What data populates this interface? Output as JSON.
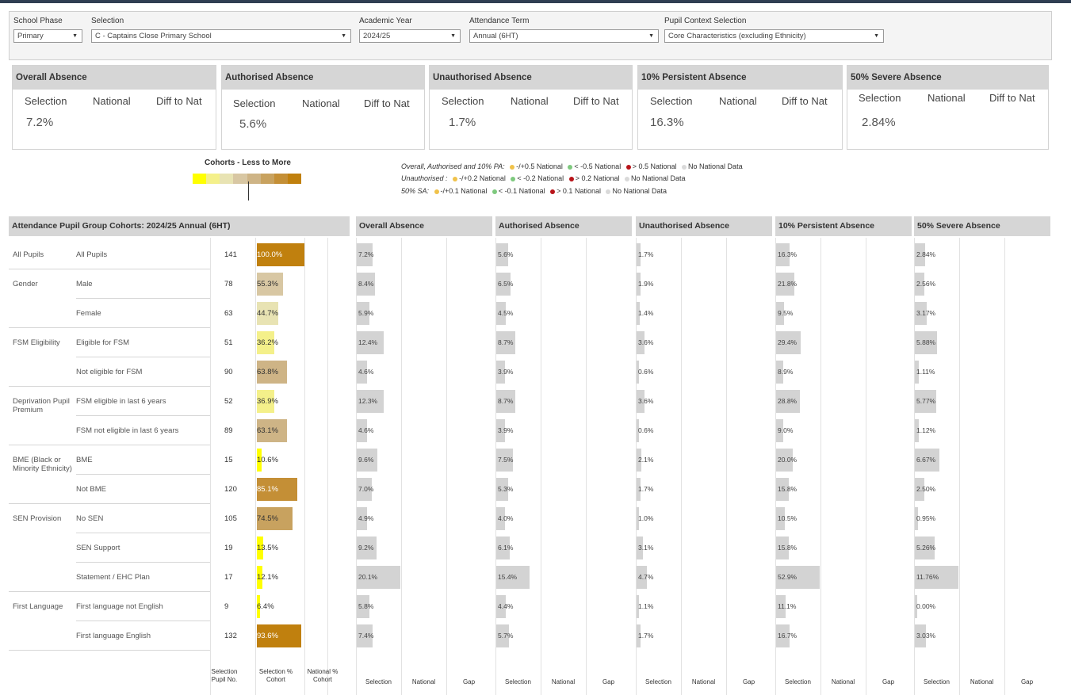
{
  "filters": {
    "school_phase": {
      "label": "School Phase",
      "value": "Primary"
    },
    "selection": {
      "label": "Selection",
      "value": "C - Captains Close Primary School"
    },
    "academic_year": {
      "label": "Academic Year",
      "value": "2024/25"
    },
    "attendance_term": {
      "label": "Attendance Term",
      "value": "Annual (6HT)"
    },
    "pupil_context": {
      "label": "Pupil Context Selection",
      "value": "Core Characteristics (excluding Ethnicity)"
    }
  },
  "kpi_col_labels": {
    "selection": "Selection",
    "national": "National",
    "diff": "Diff to Nat"
  },
  "kpis": [
    {
      "title": "Overall Absence",
      "selection": "7.2%"
    },
    {
      "title": "Authorised Absence",
      "selection": "5.6%"
    },
    {
      "title": "Unauthorised Absence",
      "selection": "1.7%"
    },
    {
      "title": "10% Persistent Absence",
      "selection": "16.3%"
    },
    {
      "title": "50% Severe Absence",
      "selection": "2.84%"
    }
  ],
  "cohort_legend": {
    "title": "Cohorts - Less to More",
    "colors": [
      "#ffff00",
      "#f4f08a",
      "#e8e3b3",
      "#d8c7a3",
      "#ceb486",
      "#c8a25f",
      "#c48f36",
      "#c0800e"
    ]
  },
  "rag_legend": {
    "line1_prefix": "Overall, Authorised and 10% PA:",
    "line1_items": [
      "-/+0.5 National",
      "< -0.5 National",
      "> 0.5 National",
      "No National Data"
    ],
    "line2_prefix": "Unauthorised :",
    "line2_items": [
      "-/+0.2 National",
      "< -0.2 National",
      "> 0.2 National",
      "No National Data"
    ],
    "line3_prefix": "50% SA:",
    "line3_items": [
      "-/+0.1 National",
      "< -0.1 National",
      "> 0.1 National",
      "No National Data"
    ],
    "colors": {
      "amber": "#f0c24a",
      "green": "#7ec97e",
      "red": "#b8141a",
      "grey": "#d9d9d9"
    }
  },
  "table_title": "Attendance Pupil Group Cohorts: 2024/25 Annual (6HT)",
  "metric_headers": [
    "Overall Absence",
    "Authorised Absence",
    "Unauthorised Absence",
    "10% Persistent Absence",
    "50% Severe Absence"
  ],
  "rows": [
    {
      "group": "All Pupils",
      "sub": "All Pupils",
      "n": "141",
      "pct": "100.0%",
      "pct_value": 100.0,
      "color": "#c0800e",
      "vals": [
        "7.2%",
        "5.6%",
        "1.7%",
        "16.3%",
        "2.84%"
      ]
    },
    {
      "group": "Gender",
      "sub": "Male",
      "n": "78",
      "pct": "55.3%",
      "pct_value": 55.3,
      "color": "#d8c7a3",
      "vals": [
        "8.4%",
        "6.5%",
        "1.9%",
        "21.8%",
        "2.56%"
      ]
    },
    {
      "group": "",
      "sub": "Female",
      "n": "63",
      "pct": "44.7%",
      "pct_value": 44.7,
      "color": "#e8e3b3",
      "vals": [
        "5.9%",
        "4.5%",
        "1.4%",
        "9.5%",
        "3.17%"
      ]
    },
    {
      "group": "FSM Eligibility",
      "sub": "Eligible for FSM",
      "n": "51",
      "pct": "36.2%",
      "pct_value": 36.2,
      "color": "#f4f08a",
      "vals": [
        "12.4%",
        "8.7%",
        "3.6%",
        "29.4%",
        "5.88%"
      ]
    },
    {
      "group": "",
      "sub": "Not eligible for FSM",
      "n": "90",
      "pct": "63.8%",
      "pct_value": 63.8,
      "color": "#ceb486",
      "vals": [
        "4.6%",
        "3.9%",
        "0.6%",
        "8.9%",
        "1.11%"
      ]
    },
    {
      "group": "Deprivation Pupil Premium",
      "sub": "FSM eligible in last 6 years",
      "n": "52",
      "pct": "36.9%",
      "pct_value": 36.9,
      "color": "#f4f08a",
      "vals": [
        "12.3%",
        "8.7%",
        "3.6%",
        "28.8%",
        "5.77%"
      ]
    },
    {
      "group": "",
      "sub": "FSM not eligible in last 6 years",
      "n": "89",
      "pct": "63.1%",
      "pct_value": 63.1,
      "color": "#ceb486",
      "vals": [
        "4.6%",
        "3.9%",
        "0.6%",
        "9.0%",
        "1.12%"
      ]
    },
    {
      "group": "BME (Black or Minority Ethnicity)",
      "sub": "BME",
      "n": "15",
      "pct": "10.6%",
      "pct_value": 10.6,
      "color": "#ffff00",
      "vals": [
        "9.6%",
        "7.5%",
        "2.1%",
        "20.0%",
        "6.67%"
      ]
    },
    {
      "group": "",
      "sub": "Not BME",
      "n": "120",
      "pct": "85.1%",
      "pct_value": 85.1,
      "color": "#c48f36",
      "vals": [
        "7.0%",
        "5.3%",
        "1.7%",
        "15.8%",
        "2.50%"
      ]
    },
    {
      "group": "SEN Provision",
      "sub": "No SEN",
      "n": "105",
      "pct": "74.5%",
      "pct_value": 74.5,
      "color": "#c8a25f",
      "vals": [
        "4.9%",
        "4.0%",
        "1.0%",
        "10.5%",
        "0.95%"
      ]
    },
    {
      "group": "",
      "sub": "SEN Support",
      "n": "19",
      "pct": "13.5%",
      "pct_value": 13.5,
      "color": "#ffff00",
      "vals": [
        "9.2%",
        "6.1%",
        "3.1%",
        "15.8%",
        "5.26%"
      ]
    },
    {
      "group": "",
      "sub": "Statement / EHC Plan",
      "n": "17",
      "pct": "12.1%",
      "pct_value": 12.1,
      "color": "#ffff00",
      "vals": [
        "20.1%",
        "15.4%",
        "4.7%",
        "52.9%",
        "11.76%"
      ]
    },
    {
      "group": "First Language",
      "sub": "First language not English",
      "n": "9",
      "pct": "6.4%",
      "pct_value": 6.4,
      "color": "#ffff00",
      "vals": [
        "5.8%",
        "4.4%",
        "1.1%",
        "11.1%",
        "0.00%"
      ]
    },
    {
      "group": "",
      "sub": "First language English",
      "n": "132",
      "pct": "93.6%",
      "pct_value": 93.6,
      "color": "#c0800e",
      "vals": [
        "7.4%",
        "5.7%",
        "1.7%",
        "16.7%",
        "3.03%"
      ]
    }
  ],
  "footer": {
    "sel_pupil_no": "Selection Pupil No.",
    "sel_pct_cohort": "Selection % Cohort",
    "nat_pct_cohort": "National % Cohort",
    "selection": "Selection",
    "national": "National",
    "gap": "Gap"
  }
}
